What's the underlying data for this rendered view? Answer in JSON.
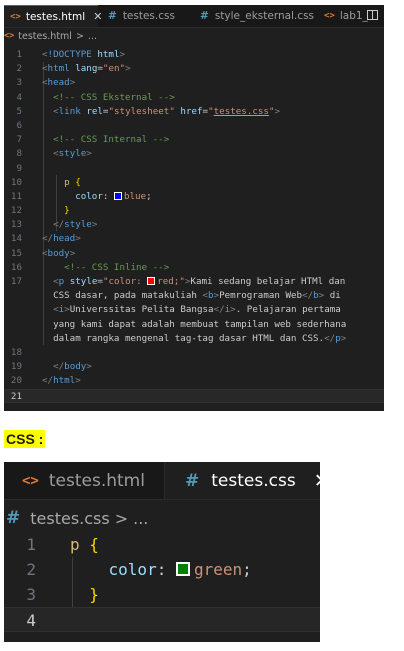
{
  "html_editor": {
    "tabs": [
      {
        "label": "testes.html",
        "icon": "html-file-icon",
        "active": true
      },
      {
        "label": "testes.css",
        "icon": "css-file-icon",
        "active": false
      },
      {
        "label": "style_eksternal.css",
        "icon": "css-file-icon",
        "active": false
      },
      {
        "label": "lab1_",
        "icon": "html-file-icon",
        "active": false
      }
    ],
    "close_symbol": "✕",
    "breadcrumb": {
      "file": "testes.html",
      "separator": ">",
      "rest": "..."
    },
    "lines": [
      {
        "n": "1",
        "tokens": [
          [
            "pun",
            "<"
          ],
          [
            "tag",
            "!DOCTYPE"
          ],
          [
            "txt",
            " "
          ],
          [
            "att",
            "html"
          ],
          [
            "pun",
            ">"
          ]
        ]
      },
      {
        "n": "2",
        "tokens": [
          [
            "pun",
            "<"
          ],
          [
            "tag",
            "html"
          ],
          [
            "txt",
            " "
          ],
          [
            "att",
            "lang"
          ],
          [
            "txt",
            "="
          ],
          [
            "str",
            "\"en\""
          ],
          [
            "pun",
            ">"
          ]
        ]
      },
      {
        "n": "3",
        "tokens": [
          [
            "pun",
            "<"
          ],
          [
            "tag",
            "head"
          ],
          [
            "pun",
            ">"
          ]
        ]
      },
      {
        "n": "4",
        "tokens": [
          [
            "txt",
            "  "
          ],
          [
            "com",
            "<!-- CSS Eksternal -->"
          ]
        ]
      },
      {
        "n": "5",
        "tokens": [
          [
            "txt",
            "  "
          ],
          [
            "pun",
            "<"
          ],
          [
            "tag",
            "link"
          ],
          [
            "txt",
            " "
          ],
          [
            "att",
            "rel"
          ],
          [
            "txt",
            "="
          ],
          [
            "str",
            "\"stylesheet\""
          ],
          [
            "txt",
            " "
          ],
          [
            "att",
            "href"
          ],
          [
            "txt",
            "="
          ],
          [
            "str",
            "\""
          ],
          [
            "str link",
            "testes.css"
          ],
          [
            "str",
            "\""
          ],
          [
            "pun",
            ">"
          ]
        ]
      },
      {
        "n": "6",
        "tokens": []
      },
      {
        "n": "7",
        "tokens": [
          [
            "txt",
            "  "
          ],
          [
            "com",
            "<!-- CSS Internal -->"
          ]
        ]
      },
      {
        "n": "8",
        "tokens": [
          [
            "txt",
            "  "
          ],
          [
            "pun",
            "<"
          ],
          [
            "tag",
            "style"
          ],
          [
            "pun",
            ">"
          ]
        ]
      },
      {
        "n": "9",
        "tokens": []
      },
      {
        "n": "10",
        "tokens": [
          [
            "txt",
            "    "
          ],
          [
            "sel",
            "p"
          ],
          [
            "txt",
            " "
          ],
          [
            "brk",
            "{"
          ]
        ]
      },
      {
        "n": "11",
        "tokens": [
          [
            "txt",
            "      "
          ],
          [
            "prop",
            "color"
          ],
          [
            "txt",
            ": "
          ],
          [
            "swatch",
            "#0000ff"
          ],
          [
            "val",
            "blue"
          ],
          [
            "txt",
            ";"
          ]
        ]
      },
      {
        "n": "12",
        "tokens": [
          [
            "txt",
            "    "
          ],
          [
            "brk",
            "}"
          ]
        ]
      },
      {
        "n": "13",
        "tokens": [
          [
            "txt",
            "  "
          ],
          [
            "pun",
            "</"
          ],
          [
            "tag",
            "style"
          ],
          [
            "pun",
            ">"
          ]
        ]
      },
      {
        "n": "14",
        "tokens": [
          [
            "pun",
            "</"
          ],
          [
            "tag",
            "head"
          ],
          [
            "pun",
            ">"
          ]
        ]
      },
      {
        "n": "15",
        "tokens": [
          [
            "pun",
            "<"
          ],
          [
            "tag",
            "body"
          ],
          [
            "pun",
            ">"
          ]
        ]
      },
      {
        "n": "16",
        "tokens": [
          [
            "txt",
            "    "
          ],
          [
            "com",
            "<!-- CSS Inline -->"
          ]
        ]
      },
      {
        "n": "17",
        "tokens": [
          [
            "txt",
            "  "
          ],
          [
            "pun",
            "<"
          ],
          [
            "tag",
            "p"
          ],
          [
            "txt",
            " "
          ],
          [
            "att",
            "style"
          ],
          [
            "txt",
            "="
          ],
          [
            "str",
            "\"color: "
          ],
          [
            "swatch",
            "#ff0000"
          ],
          [
            "str",
            "red;\""
          ],
          [
            "pun",
            ">"
          ],
          [
            "txt",
            "Kami sedang belajar HTMl dan"
          ]
        ]
      },
      {
        "n": "",
        "tokens": [
          [
            "txt",
            "  CSS dasar, pada matakuliah "
          ],
          [
            "pun",
            "<"
          ],
          [
            "tag",
            "b"
          ],
          [
            "pun",
            ">"
          ],
          [
            "txt",
            "Pemrograman Web"
          ],
          [
            "pun",
            "</"
          ],
          [
            "tag",
            "b"
          ],
          [
            "pun",
            ">"
          ],
          [
            "txt",
            " di"
          ]
        ]
      },
      {
        "n": "",
        "tokens": [
          [
            "txt",
            "  "
          ],
          [
            "pun",
            "<"
          ],
          [
            "tag",
            "i"
          ],
          [
            "pun",
            ">"
          ],
          [
            "txt",
            "Universsitas Pelita Bangsa"
          ],
          [
            "pun",
            "</"
          ],
          [
            "tag",
            "i"
          ],
          [
            "pun",
            ">"
          ],
          [
            "txt",
            ". Pelajaran pertama"
          ]
        ]
      },
      {
        "n": "",
        "tokens": [
          [
            "txt",
            "  yang kami dapat adalah membuat tampilan web sederhana"
          ]
        ]
      },
      {
        "n": "",
        "tokens": [
          [
            "txt",
            "  dalam rangka mengenal tag-tag dasar HTML dan CSS."
          ],
          [
            "pun",
            "</"
          ],
          [
            "tag",
            "p"
          ],
          [
            "pun",
            ">"
          ]
        ]
      },
      {
        "n": "18",
        "tokens": []
      },
      {
        "n": "19",
        "tokens": [
          [
            "txt",
            "  "
          ],
          [
            "pun",
            "</"
          ],
          [
            "tag",
            "body"
          ],
          [
            "pun",
            ">"
          ]
        ]
      },
      {
        "n": "20",
        "tokens": [
          [
            "pun",
            "</"
          ],
          [
            "tag",
            "html"
          ],
          [
            "pun",
            ">"
          ]
        ]
      },
      {
        "n": "21",
        "tokens": [],
        "current": true
      }
    ]
  },
  "css_label": "CSS :",
  "css_editor": {
    "tabs": [
      {
        "label": "testes.html",
        "icon": "html-file-icon",
        "active": false
      },
      {
        "label": "testes.css",
        "icon": "css-file-icon",
        "active": true
      }
    ],
    "close_symbol": "✕",
    "breadcrumb": {
      "file": "testes.css",
      "separator": ">",
      "rest": "..."
    },
    "lines": [
      {
        "n": "1",
        "tokens": [
          [
            "sel",
            "p"
          ],
          [
            "txt",
            " "
          ],
          [
            "brk",
            "{"
          ]
        ]
      },
      {
        "n": "2",
        "tokens": [
          [
            "txt",
            "    "
          ],
          [
            "prop",
            "color"
          ],
          [
            "txt",
            ": "
          ],
          [
            "swatch",
            "#008000"
          ],
          [
            "val",
            "green"
          ],
          [
            "txt",
            ";"
          ]
        ]
      },
      {
        "n": "3",
        "tokens": [
          [
            "txt",
            "  "
          ],
          [
            "brk",
            "}"
          ]
        ]
      },
      {
        "n": "4",
        "tokens": [],
        "current": true
      }
    ]
  },
  "theme": {
    "editor_bg": "#1f1f1f",
    "tab_bar_bg": "#181818",
    "active_tab_accent": "#0078d4",
    "label_highlight": "#ffff00"
  }
}
